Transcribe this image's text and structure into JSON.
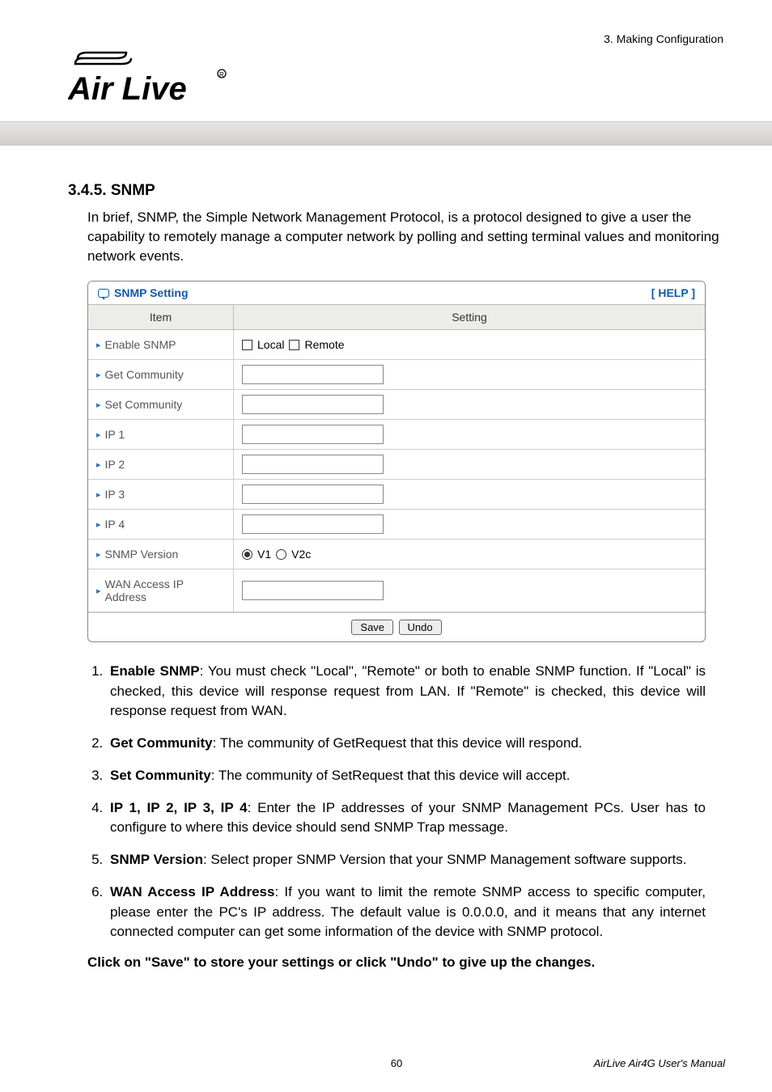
{
  "chapter_heading": "3. Making Configuration",
  "section_number": "3.4.5.  SNMP",
  "intro_para": "In brief, SNMP, the Simple Network Management Protocol, is a protocol designed to give a user the capability to remotely manage a computer network by polling and setting terminal values and monitoring network events.",
  "table": {
    "title": "SNMP Setting",
    "help": "[ HELP ]",
    "head_item": "Item",
    "head_setting": "Setting",
    "rows": {
      "enable": {
        "label": "Enable SNMP",
        "opt1": "Local",
        "opt2": "Remote"
      },
      "get": {
        "label": "Get Community"
      },
      "set": {
        "label": "Set Community"
      },
      "ip1": {
        "label": "IP 1"
      },
      "ip2": {
        "label": "IP 2"
      },
      "ip3": {
        "label": "IP 3"
      },
      "ip4": {
        "label": "IP 4"
      },
      "ver": {
        "label": "SNMP Version",
        "v1": "V1",
        "v2": "V2c"
      },
      "wan": {
        "label": "WAN Access IP Address"
      }
    },
    "save": "Save",
    "undo": "Undo"
  },
  "points": [
    {
      "b": "Enable SNMP",
      "t": ": You must check \"Local\", \"Remote\" or both to enable SNMP function. If \"Local\" is checked, this device will response request from LAN. If \"Remote\" is checked, this device will response request from WAN."
    },
    {
      "b": "Get Community",
      "t": ": The community of GetRequest that this device will respond."
    },
    {
      "b": "Set Community",
      "t": ": The community of SetRequest that this device will accept."
    },
    {
      "b": "IP 1, IP 2, IP 3, IP 4",
      "t": ": Enter the IP addresses of your SNMP Management PCs. User has to configure to where this device should send SNMP Trap message."
    },
    {
      "b": "SNMP Version",
      "t": ": Select proper SNMP Version that your SNMP Management software supports."
    },
    {
      "b": "WAN Access IP Address",
      "t": ": If you want to limit the remote SNMP access to specific computer, please enter the PC's IP address. The default value is 0.0.0.0, and it means that any internet connected computer can get some information of the device with SNMP protocol."
    }
  ],
  "closing": "Click on \"Save\" to store your settings or click \"Undo\" to give up the changes.",
  "footer_page": "60",
  "footer_manual": "AirLive Air4G User's Manual"
}
